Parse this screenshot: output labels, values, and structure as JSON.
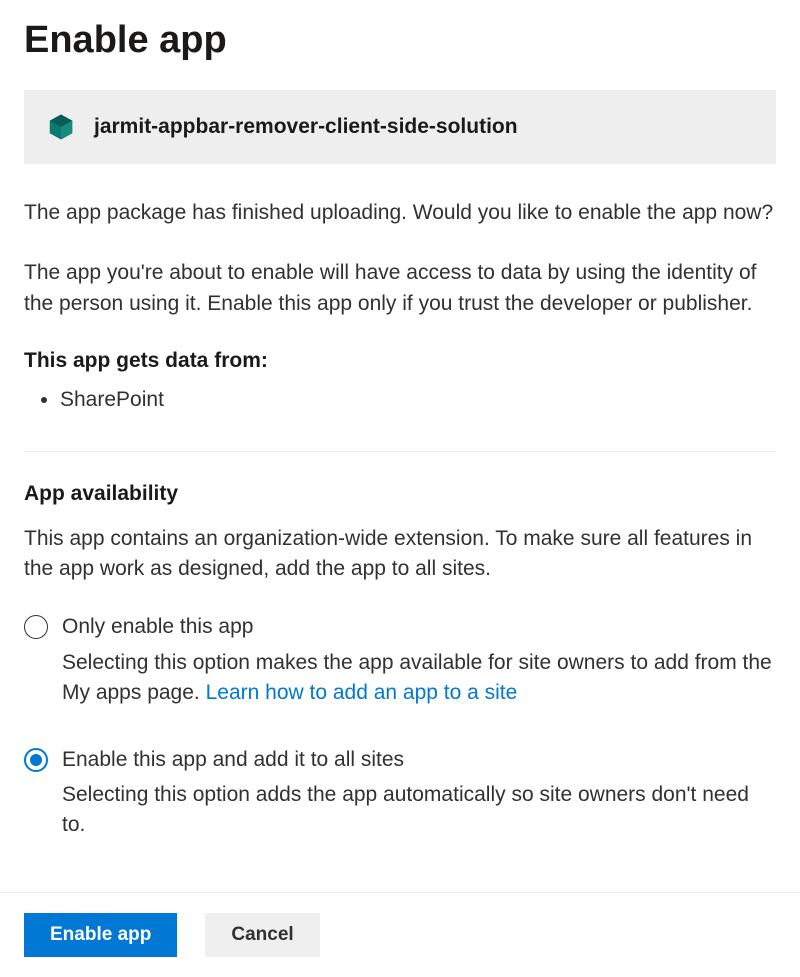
{
  "title": "Enable app",
  "app": {
    "name": "jarmit-appbar-remover-client-side-solution"
  },
  "intro": "The app package has finished uploading. Would you like to enable the app now?",
  "warning": "The app you're about to enable will have access to data by using the identity of the person using it. Enable this app only if you trust the developer or publisher.",
  "dataFrom": {
    "heading": "This app gets data from:",
    "items": [
      "SharePoint"
    ]
  },
  "availability": {
    "heading": "App availability",
    "description": "This app contains an organization-wide extension. To make sure all features in the app work as designed, add the app to all sites.",
    "options": [
      {
        "label": "Only enable this app",
        "description": "Selecting this option makes the app available for site owners to add from the My apps page. ",
        "linkText": "Learn how to add an app to a site",
        "selected": false
      },
      {
        "label": "Enable this app and add it to all sites",
        "description": "Selecting this option adds the app automatically so site owners don't need to.",
        "selected": true
      }
    ]
  },
  "buttons": {
    "primary": "Enable app",
    "secondary": "Cancel"
  }
}
